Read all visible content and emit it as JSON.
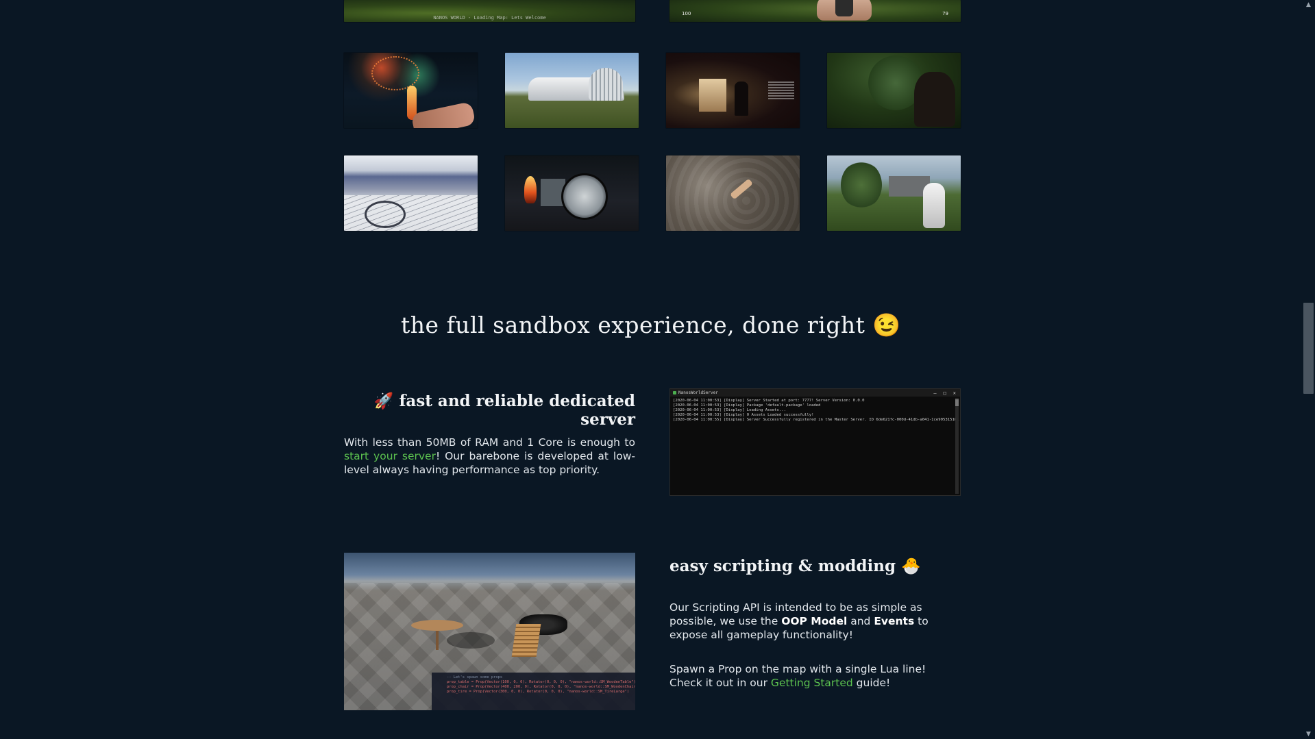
{
  "gallery": {
    "top_left_caption": "NANOS WORLD - Loading Map: Lets Welcome",
    "top_right_hud_left": "100",
    "top_right_hud_right": "79"
  },
  "section": {
    "heading": "the full sandbox experience, done right 😉"
  },
  "server": {
    "title": "🚀 fast and reliable dedicated server",
    "text_before_link": "With less than 50MB of RAM and 1 Core is enough to ",
    "link_text": "start your server",
    "text_after_link": "! Our barebone is developed at low-level always having performance as top priority.",
    "console_title": "NanosWorldServer",
    "console_lines": [
      "[2020-06-04 11:00:53] [Display]  Server Started at port: 7777! Server Version: 0.0.0",
      "[2020-06-04 11:00:53] [Display]  Package 'default-package' loaded",
      "[2020-06-04 11:00:53] [Display]  Loading Assets...",
      "[2020-06-04 11:00:53] [Display]  0 Assets Loaded successfully!",
      "[2020-06-04 11:00:55] [Display]  Server Successfully registered in the Master Server. ID 6de621fc-000d-41db-a041-1ce905315101"
    ]
  },
  "scripting": {
    "title": "easy scripting & modding 🐣",
    "p1_before": "Our Scripting API is intended to be as simple as possible, we use the ",
    "p1_bold1": "OOP Model",
    "p1_mid": " and ",
    "p1_bold2": "Events",
    "p1_after": " to expose all gameplay functionality!",
    "p2_before": "Spawn a Prop on the map with a single Lua line! Check it out in our ",
    "p2_link": "Getting Started",
    "p2_after": " guide!",
    "code_comment": "-- Let's spawn some props",
    "code_lines": [
      "prop_table = Prop(Vector(100, 0, 0), Rotator(0, 0, 0), \"nanos-world::SM_WoodenTable\")",
      "prop_chair = Prop(Vector(400, 200, 0), Rotator(0, 0, 0), \"nanos-world::SM_WoodenChair\")",
      "prop_tire = Prop(Vector(300, 0, 0), Rotator(0, 0, 0), \"nanos-world::SM_TireLarge\")"
    ]
  },
  "colors": {
    "background": "#0a1724",
    "link": "#5cc24f",
    "text": "#e2e7ec"
  },
  "scrollbar": {
    "up_glyph": "▲",
    "down_glyph": "▼"
  }
}
